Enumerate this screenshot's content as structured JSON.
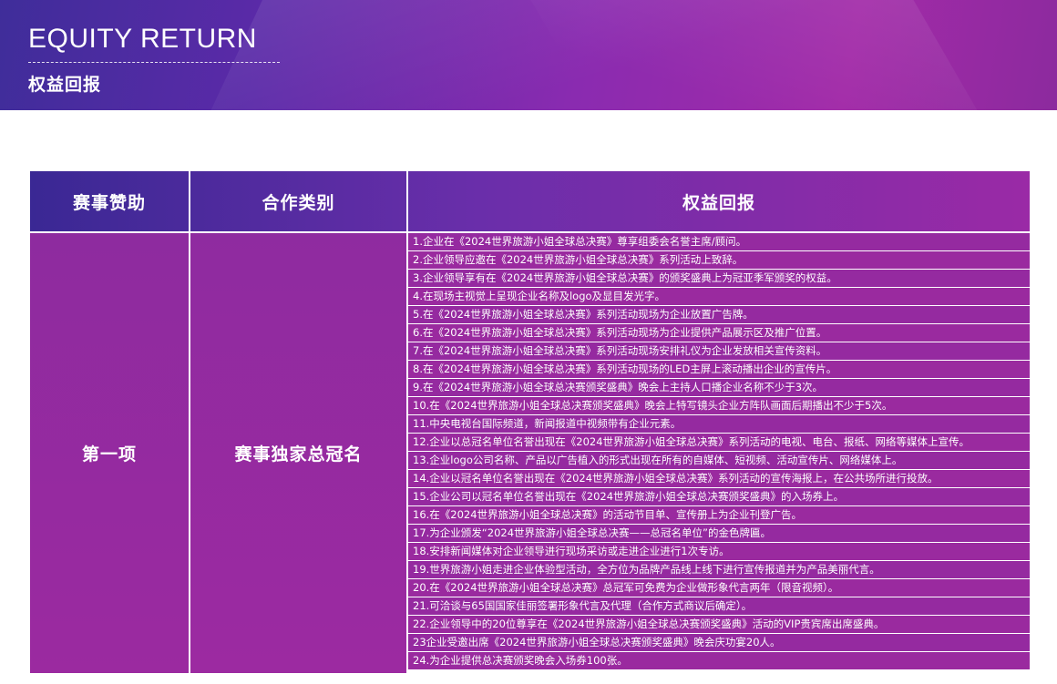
{
  "header": {
    "title_en": "EQUITY RETURN",
    "title_cn": "权益回报"
  },
  "table": {
    "columns": [
      "赛事赞助",
      "合作类别",
      "权益回报"
    ],
    "sponsor_item": "第一项",
    "category": "赛事独家总冠名",
    "benefits": [
      "1.企业在《2024世界旅游小姐全球总决赛》尊享组委会名誉主席/顾问。",
      "2.企业领导应邀在《2024世界旅游小姐全球总决赛》系列活动上致辞。",
      "3.企业领导享有在《2024世界旅游小姐全球总决赛》的颁奖盛典上为冠亚季军颁奖的权益。",
      "4.在现场主视觉上呈现企业名称及logo及显目发光字。",
      "5.在《2024世界旅游小姐全球总决赛》系列活动现场为企业放置广告牌。",
      "6.在《2024世界旅游小姐全球总决赛》系列活动现场为企业提供产品展示区及推广位置。",
      "7.在《2024世界旅游小姐全球总决赛》系列活动现场安排礼仪为企业发放相关宣传资料。",
      "8.在《2024世界旅游小姐全球总决赛》系列活动现场的LED主屏上滚动播出企业的宣传片。",
      "9.在《2024世界旅游小姐全球总决赛颁奖盛典》晚会上主持人口播企业名称不少于3次。",
      "10.在《2024世界旅游小姐全球总决赛颁奖盛典》晚会上特写镜头企业方阵队画面后期播出不少于5次。",
      "11.中央电视台国际频道，新闻报道中视频带有企业元素。",
      "12.企业以总冠名单位名誉出现在《2024世界旅游小姐全球总决赛》系列活动的电视、电台、报纸、网络等媒体上宣传。",
      "13.企业logo公司名称、产品以广告植入的形式出现在所有的自媒体、短视频、活动宣传片、网络媒体上。",
      "14.企业以冠名单位名誉出现在《2024世界旅游小姐全球总决赛》系列活动的宣传海报上，在公共场所进行投放。",
      "15.企业公司以冠名单位名誉出现在《2024世界旅游小姐全球总决赛颁奖盛典》的入场券上。",
      "16.在《2024世界旅游小姐全球总决赛》的活动节目单、宣传册上为企业刊登广告。",
      "17.为企业颁发“2024世界旅游小姐全球总决赛——总冠名单位”的金色牌匾。",
      "18.安排新闻媒体对企业领导进行现场采访或走进企业进行1次专访。",
      "19.世界旅游小姐走进企业体验型活动，全方位为品牌产品线上线下进行宣传报道并为产品美丽代言。",
      "20.在《2024世界旅游小姐全球总决赛》总冠军可免费为企业做形象代言两年（限音视频）。",
      "21.可洽谈与65国国家佳丽签署形象代言及代理（合作方式商议后确定）。",
      "22.企业领导中的20位尊享在《2024世界旅游小姐全球总决赛颁奖盛典》活动的VIP贵宾席出席盛典。",
      "23企业受邀出席《2024世界旅游小姐全球总决赛颁奖盛典》晚会庆功宴20人。",
      "24.为企业提供总决赛颁奖晚会入场券100张。"
    ]
  }
}
